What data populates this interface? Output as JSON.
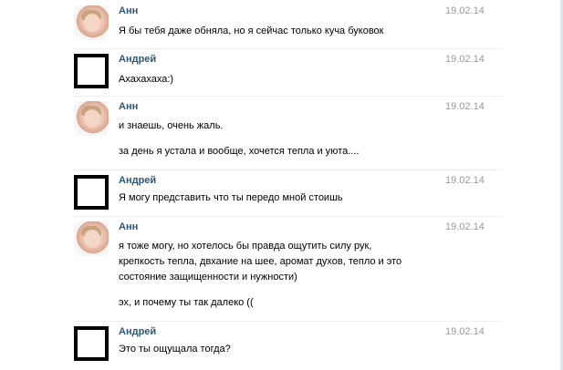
{
  "messages": [
    {
      "author": "Анн",
      "date": "19.02.14",
      "avatar": "photo",
      "lines": [
        "Я бы тебя даже обняла, но я сейчас только куча буковок"
      ]
    },
    {
      "author": "Андрей",
      "date": "19.02.14",
      "avatar": "black-square",
      "lines": [
        "Ахахахаха:)"
      ]
    },
    {
      "author": "Анн",
      "date": "19.02.14",
      "avatar": "photo",
      "lines": [
        "и знаешь, очень жаль.",
        "за день я устала и вообще, хочется тепла и уюта...."
      ]
    },
    {
      "author": "Андрей",
      "date": "19.02.14",
      "avatar": "black-square",
      "lines": [
        "Я могу представить что ты передо мной стоишь"
      ]
    },
    {
      "author": "Анн",
      "date": "19.02.14",
      "avatar": "photo",
      "lines": [
        "я тоже могу, но хотелось бы правда ощутить силу рук,",
        "крепкость тепла, двхание на шее, аромат духов, тепло и это",
        "состояние защищенности и нужности)",
        "эх, и почему ты так далеко (("
      ]
    },
    {
      "author": "Андрей",
      "date": "19.02.14",
      "avatar": "black-square",
      "lines": [
        "Это ты ощущала тогда?"
      ]
    }
  ],
  "colors": {
    "author": "#2b587a",
    "date": "#999999",
    "text": "#000000",
    "background": "#ffffff"
  }
}
